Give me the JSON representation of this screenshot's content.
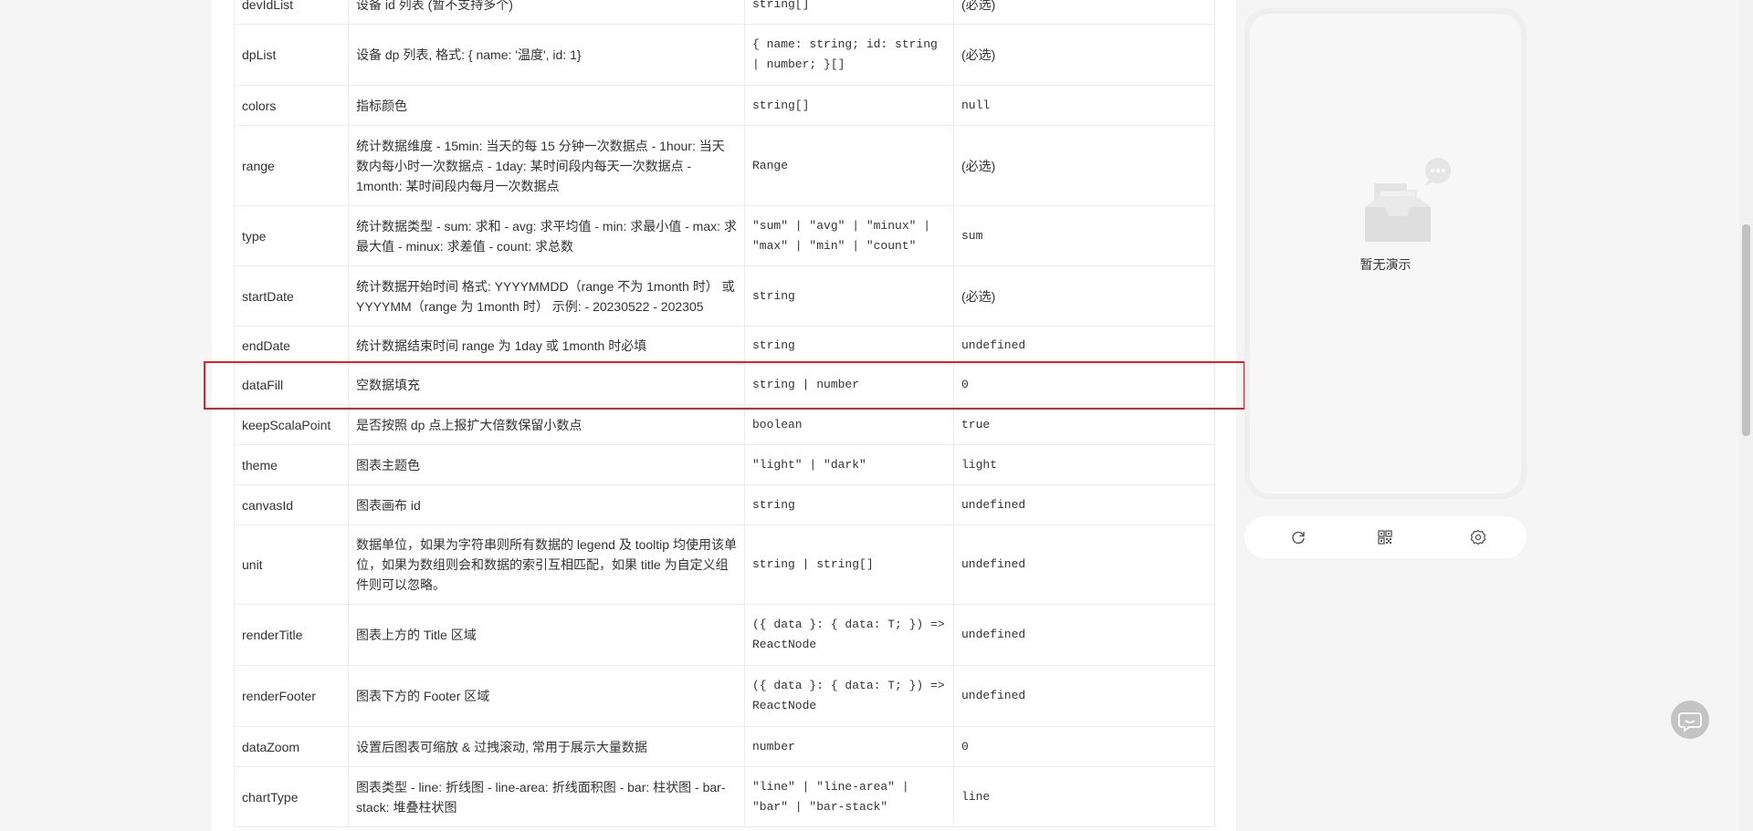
{
  "api_table": {
    "rows": [
      {
        "prop": "devIdList",
        "desc": "设备 id 列表 (暂不支持多个)",
        "type": "string[]",
        "default": "(必选)"
      },
      {
        "prop": "dpList",
        "desc": "设备 dp 列表, 格式: { name: '温度', id: 1}",
        "type": "{ name: string; id: string | number; }[]",
        "default": "(必选)"
      },
      {
        "prop": "colors",
        "desc": "指标颜色",
        "type": "string[]",
        "default": "null"
      },
      {
        "prop": "range",
        "desc": "统计数据维度 - 15min: 当天的每 15 分钟一次数据点 - 1hour: 当天数内每小时一次数据点 - 1day: 某时间段内每天一次数据点 - 1month: 某时间段内每月一次数据点",
        "type": "Range",
        "default": "(必选)"
      },
      {
        "prop": "type",
        "desc": "统计数据类型 - sum: 求和 - avg: 求平均值 - min: 求最小值 - max: 求最大值 - minux: 求差值 - count: 求总数",
        "type": "\"sum\" | \"avg\" | \"minux\" | \"max\" | \"min\" | \"count\"",
        "default": "sum"
      },
      {
        "prop": "startDate",
        "desc": "统计数据开始时间 格式: YYYYMMDD（range 不为 1month 时） 或 YYYYMM（range 为 1month 时） 示例: - 20230522 - 202305",
        "type": "string",
        "default": "(必选)"
      },
      {
        "prop": "endDate",
        "desc": "统计数据结束时间 range 为 1day 或 1month 时必填",
        "type": "string",
        "default": "undefined"
      },
      {
        "prop": "dataFill",
        "desc": "空数据填充",
        "type": "string | number",
        "default": "0"
      },
      {
        "prop": "keepScalaPoint",
        "desc": "是否按照 dp 点上报扩大倍数保留小数点",
        "type": "boolean",
        "default": "true"
      },
      {
        "prop": "theme",
        "desc": "图表主题色",
        "type": "\"light\" | \"dark\"",
        "default": "light"
      },
      {
        "prop": "canvasId",
        "desc": "图表画布 id",
        "type": "string",
        "default": "undefined"
      },
      {
        "prop": "unit",
        "desc": "数据单位，如果为字符串则所有数据的 legend 及 tooltip 均使用该单位，如果为数组则会和数据的索引互相匹配，如果 title 为自定义组件则可以忽略。",
        "type": "string | string[]",
        "default": "undefined"
      },
      {
        "prop": "renderTitle",
        "desc": "图表上方的 Title 区域",
        "type": "({ data }: { data: T; }) => ReactNode",
        "default": "undefined"
      },
      {
        "prop": "renderFooter",
        "desc": "图表下方的 Footer 区域",
        "type": "({ data }: { data: T; }) => ReactNode",
        "default": "undefined"
      },
      {
        "prop": "dataZoom",
        "desc": "设置后图表可缩放 & 过拽滚动, 常用于展示大量数据",
        "type": "number",
        "default": "0"
      },
      {
        "prop": "chartType",
        "desc": "图表类型 - line: 折线图 - line-area: 折线面积图 - bar: 柱状图 - bar-stack: 堆叠柱状图",
        "type": "\"line\" | \"line-area\" | \"bar\" | \"bar-stack\"",
        "default": "line"
      }
    ]
  },
  "preview": {
    "empty_text": "暂无演示",
    "toolbar_icons": [
      "refresh-icon",
      "qrcode-icon",
      "settings-icon"
    ]
  },
  "colors": {
    "highlight": "#e0202a",
    "border": "#ececec"
  }
}
